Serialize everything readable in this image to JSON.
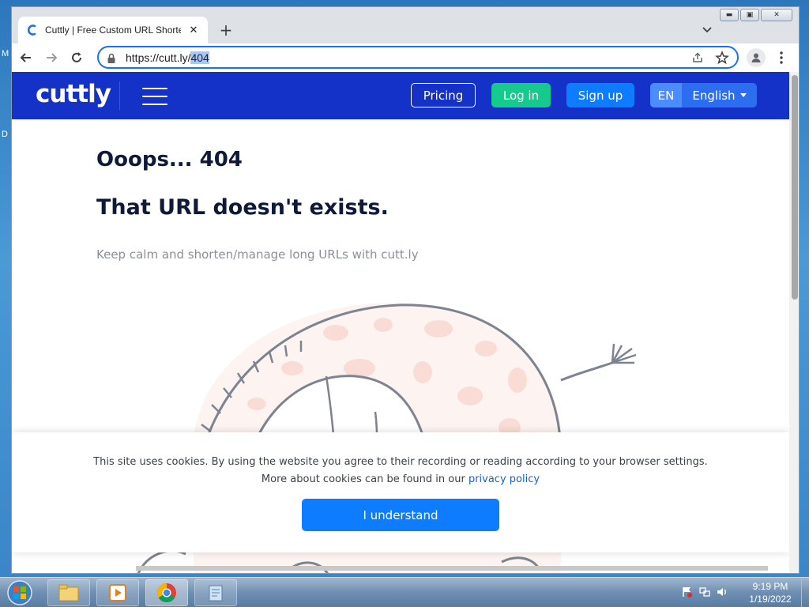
{
  "browser": {
    "tab_title": "Cuttly | Free Custom URL Shortener",
    "tab_close": "✕",
    "new_tab": "+",
    "url_prefix": "https://cutt.ly/",
    "url_selected": "404",
    "window_buttons": {
      "minimize": "▬",
      "maximize": "▣",
      "close": "✕"
    }
  },
  "site": {
    "logo": "cuttly",
    "nav": {
      "pricing": "Pricing",
      "login": "Log in",
      "signup": "Sign up",
      "lang_code": "EN",
      "lang_name": "English"
    },
    "colors": {
      "header": "#1431c8",
      "login": "#16c98d",
      "signup": "#0d7cff"
    }
  },
  "main": {
    "title": "Ooops... 404",
    "subtitle": "That URL doesn't exists.",
    "tagline": "Keep calm and shorten/manage long URLs with cutt.ly"
  },
  "cookie": {
    "line1": "This site uses cookies. By using the website you agree to their recording or reading according to your browser settings.",
    "line2_prefix": "More about cookies can be found in our ",
    "privacy_link": "privacy policy",
    "button": "I understand"
  },
  "desktop": {
    "label_m": "M",
    "label_d": "D"
  },
  "taskbar": {
    "time": "9:19 PM",
    "date": "1/19/2022"
  }
}
